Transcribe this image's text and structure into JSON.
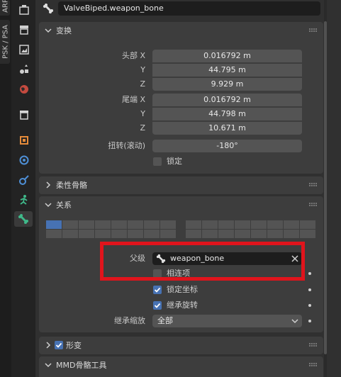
{
  "side_tabs": [
    "ARP",
    "PSK / PSA"
  ],
  "icons": [
    "tool-icon",
    "render-icon",
    "output-icon",
    "view-layer-icon",
    "scene-icon",
    "world-icon",
    "collection-icon",
    "object-icon",
    "modifiers-icon",
    "particles-icon",
    "physics-icon",
    "object-constraints-icon",
    "data-icon",
    "bone-icon"
  ],
  "header": {
    "bone_name": "ValveBiped.weapon_bone"
  },
  "transform": {
    "title": "变换",
    "head_labels": [
      "头部 X",
      "Y",
      "Z"
    ],
    "head_values": [
      "0.016792 m",
      "44.795 m",
      "9.929 m"
    ],
    "tail_labels": [
      "尾端 X",
      "Y",
      "Z"
    ],
    "tail_values": [
      "0.016792 m",
      "44.798 m",
      "10.671 m"
    ],
    "roll_label": "扭转(滚动)",
    "roll_value": "-180°",
    "lock_label": "锁定"
  },
  "bendy_bones": {
    "title": "柔性骨骼"
  },
  "relations": {
    "title": "关系",
    "parent_label": "父级",
    "parent_value": "weapon_bone",
    "connected_label": "相连项",
    "local_location_label": "锁定坐标",
    "inherit_rotation_label": "继承旋转",
    "inherit_scale_label": "继承缩放",
    "inherit_scale_value": "全部"
  },
  "shape": {
    "title": "形变"
  },
  "mmd": {
    "title": "MMD骨骼工具"
  },
  "colors": {
    "accent": "#4772b3",
    "highlight_box": "#e0141c"
  }
}
